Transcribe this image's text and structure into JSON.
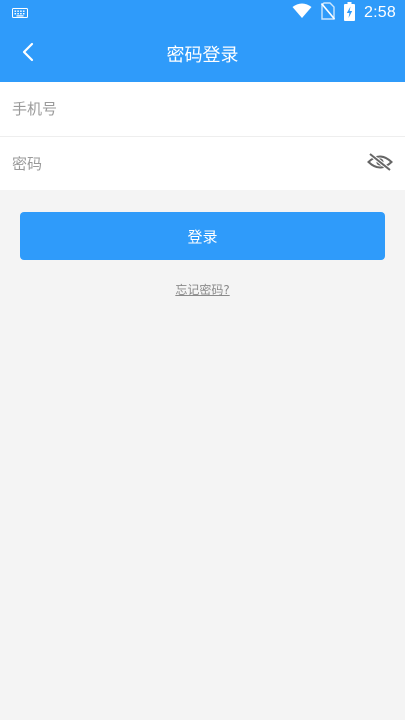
{
  "status_bar": {
    "time": "2:58",
    "icons": [
      "keyboard-icon",
      "wifi-icon",
      "no-sim-icon",
      "battery-charging-icon"
    ]
  },
  "header": {
    "back_icon": "chevron-left-icon",
    "title": "密码登录"
  },
  "form": {
    "phone": {
      "placeholder": "手机号",
      "value": ""
    },
    "password": {
      "placeholder": "密码",
      "value": "",
      "toggle_icon": "eye-off-icon"
    }
  },
  "actions": {
    "login_label": "登录",
    "forgot_label": "忘记密码?"
  },
  "colors": {
    "primary": "#2f9bfa",
    "background": "#f4f4f4",
    "placeholder": "#9a9a9a",
    "link": "#8a8a8a"
  }
}
